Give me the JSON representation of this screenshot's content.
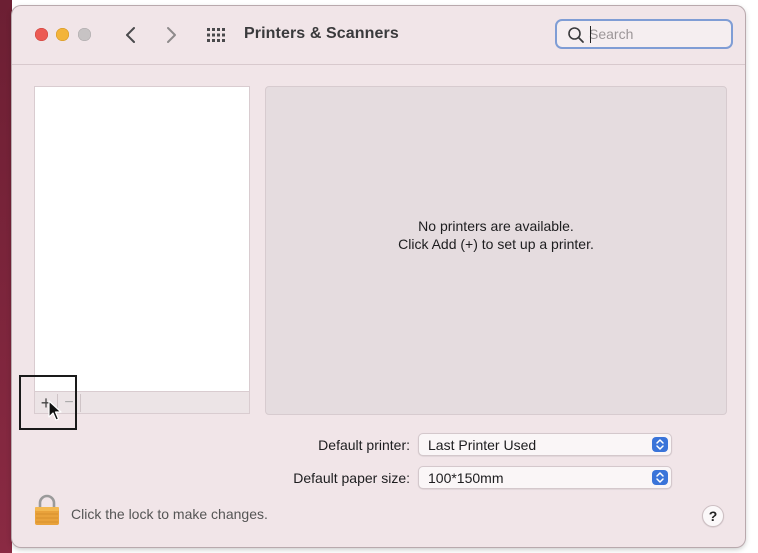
{
  "window": {
    "title": "Printers & Scanners"
  },
  "toolbar": {
    "back_icon": "chevron-left-icon",
    "forward_icon": "chevron-right-icon",
    "grid_icon": "show-all-grid-icon"
  },
  "search": {
    "placeholder": "Search",
    "value": ""
  },
  "printer_list": {
    "items": [],
    "add_label": "+",
    "remove_label": "−"
  },
  "detail": {
    "empty_line1": "No printers are available.",
    "empty_line2": "Click Add (+) to set up a printer."
  },
  "settings": {
    "default_printer_label": "Default printer:",
    "default_printer_value": "Last Printer Used",
    "paper_size_label": "Default paper size:",
    "paper_size_value": "100*150mm"
  },
  "footer": {
    "lock_text": "Click the lock to make changes.",
    "help_label": "?"
  },
  "colors": {
    "window_bg": "#f1e5e8",
    "accent": "#3a74d9",
    "close": "#ec5b54",
    "minimize": "#f3b43a",
    "lock": "#e9a23b"
  }
}
